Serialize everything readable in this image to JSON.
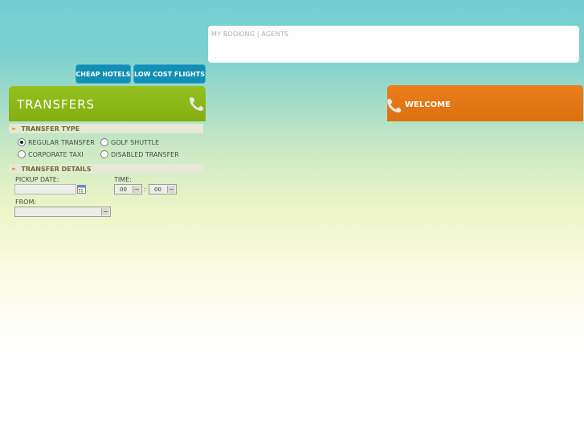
{
  "top_links": {
    "booking": "MY BOOKING",
    "separator": "|",
    "agents": "AGENTS"
  },
  "nav": {
    "hotels": "CHEAP HOTELS",
    "flights": "LOW COST FLIGHTS"
  },
  "panel": {
    "title": "TRANSFERS",
    "transfer_type": {
      "heading": "TRANSFER TYPE",
      "options": [
        {
          "label": "REGULAR TRANSFER",
          "checked": true
        },
        {
          "label": "GOLF SHUTTLE",
          "checked": false
        },
        {
          "label": "CORPORATE TAXI",
          "checked": false
        },
        {
          "label": "DISABLED TRANSFER",
          "checked": false
        }
      ]
    },
    "details": {
      "heading": "TRANSFER DETAILS",
      "pickup_label": "PICKUP DATE:",
      "time_label": "TIME:",
      "hour": "00",
      "colon": ":",
      "minute": "00",
      "from_label": "FROM:"
    }
  },
  "welcome": {
    "title": "WELCOME"
  },
  "colors": {
    "green": "#8cb918",
    "orange": "#e27712",
    "blue": "#128fb4"
  }
}
